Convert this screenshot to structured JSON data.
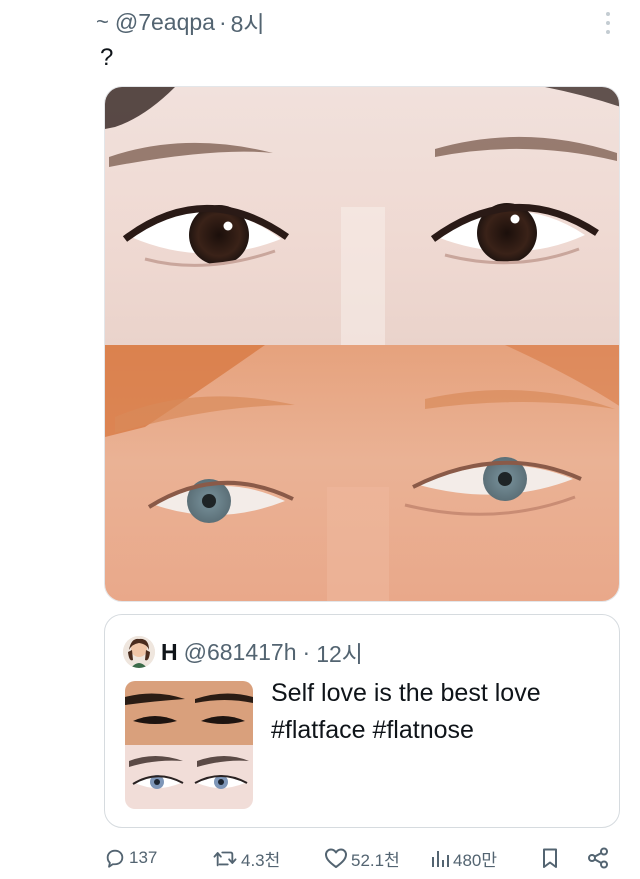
{
  "tweet": {
    "tilde": "~",
    "handle": "@7eaqpa",
    "separator": "·",
    "time": "8시",
    "text": "?",
    "more_icon": "more-vertical-icon"
  },
  "quote": {
    "name": "H",
    "handle": "@681417h",
    "separator": "·",
    "time": "12시",
    "text_line1": "Self love is the best love",
    "text_line2": "#flatface #flatnose"
  },
  "actions": {
    "replies": "137",
    "retweets": "4.3천",
    "likes": "52.1천",
    "views": "480만",
    "icons": [
      "reply-icon",
      "retweet-icon",
      "like-icon",
      "views-icon",
      "bookmark-icon",
      "share-icon"
    ]
  },
  "colors": {
    "text": "#0f1419",
    "muted": "#536471",
    "border": "#d6dbdf"
  }
}
